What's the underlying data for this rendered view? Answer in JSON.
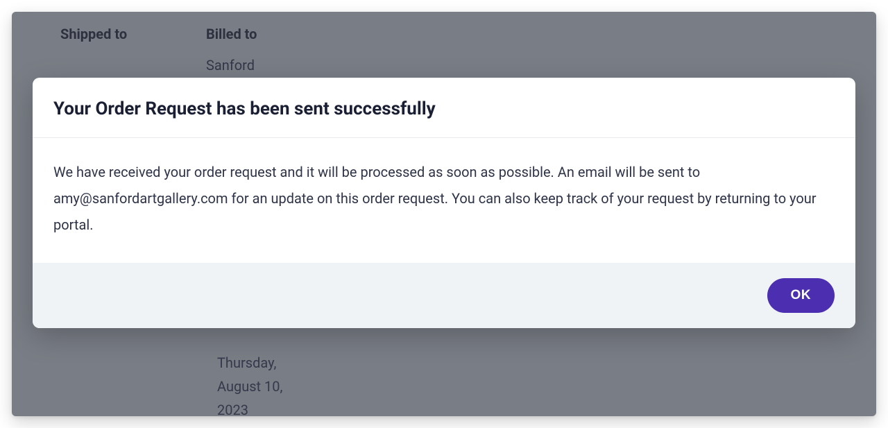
{
  "background": {
    "shipped_to_label": "Shipped to",
    "billed_to_label": "Billed to",
    "billed_to_name": "Sanford",
    "date_partial_line1": "Thursday,",
    "date_line2": "August 10,",
    "date_line3": "2023"
  },
  "modal": {
    "title": "Your Order Request has been sent successfully",
    "message": "We have received your order request and it will be processed as soon as possible. An email will be sent to amy@sanfordartgallery.com for an update on this order request. You can also keep track of your request by returning to your portal.",
    "ok_label": "OK"
  }
}
